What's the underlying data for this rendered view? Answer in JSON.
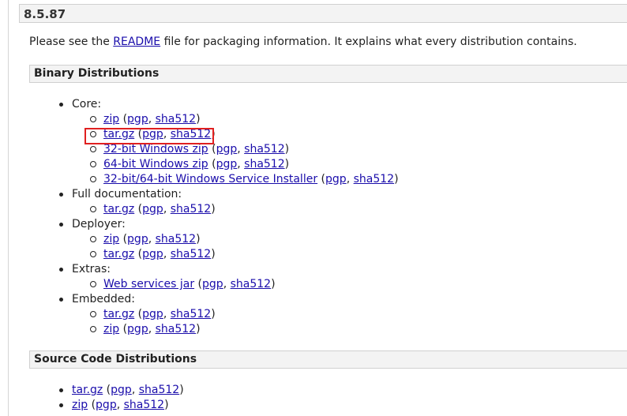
{
  "version": "8.5.87",
  "intro": {
    "before": "Please see the ",
    "link": "README",
    "after": " file for packaging information. It explains what every distribution contains."
  },
  "binary": {
    "heading": "Binary Distributions",
    "groups": [
      {
        "label": "Core:",
        "items": [
          {
            "name": "zip",
            "sig": "pgp",
            "hash": "sha512"
          },
          {
            "name": "tar.gz",
            "sig": "pgp",
            "hash": "sha512"
          },
          {
            "name": "32-bit Windows zip",
            "sig": "pgp",
            "hash": "sha512"
          },
          {
            "name": "64-bit Windows zip",
            "sig": "pgp",
            "hash": "sha512"
          },
          {
            "name": "32-bit/64-bit Windows Service Installer",
            "sig": "pgp",
            "hash": "sha512"
          }
        ]
      },
      {
        "label": "Full documentation:",
        "items": [
          {
            "name": "tar.gz",
            "sig": "pgp",
            "hash": "sha512"
          }
        ]
      },
      {
        "label": "Deployer:",
        "items": [
          {
            "name": "zip",
            "sig": "pgp",
            "hash": "sha512"
          },
          {
            "name": "tar.gz",
            "sig": "pgp",
            "hash": "sha512"
          }
        ]
      },
      {
        "label": "Extras:",
        "items": [
          {
            "name": "Web services jar",
            "sig": "pgp",
            "hash": "sha512"
          }
        ]
      },
      {
        "label": "Embedded:",
        "items": [
          {
            "name": "tar.gz",
            "sig": "pgp",
            "hash": "sha512"
          },
          {
            "name": "zip",
            "sig": "pgp",
            "hash": "sha512"
          }
        ]
      }
    ]
  },
  "source": {
    "heading": "Source Code Distributions",
    "items": [
      {
        "name": "tar.gz",
        "sig": "pgp",
        "hash": "sha512"
      },
      {
        "name": "zip",
        "sig": "pgp",
        "hash": "sha512"
      }
    ]
  },
  "punct": {
    "open": " (",
    "comma": ", ",
    "close": ")"
  },
  "colors": {
    "link": "#1a0dab",
    "highlight": "#e02020",
    "box_bg": "#f3f3f3"
  }
}
